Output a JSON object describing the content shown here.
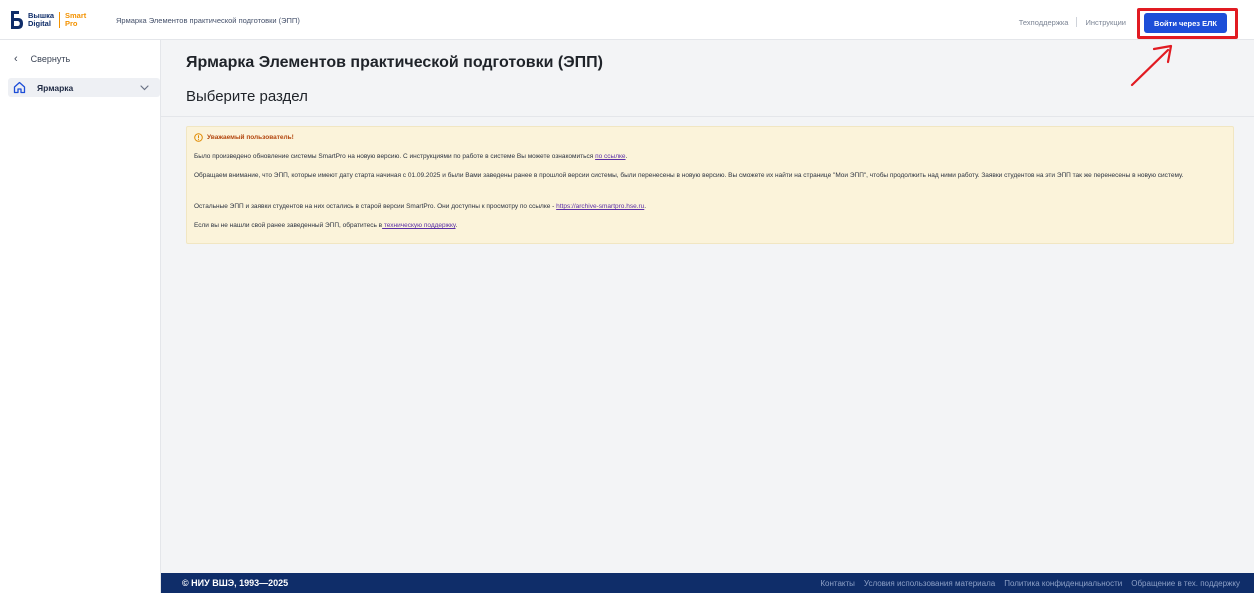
{
  "header": {
    "logo_line1": "Вышка",
    "logo_line2": "Digital",
    "logo_smart1": "Smart",
    "logo_smart2": "Pro",
    "title": "Ярмарка Элементов практической подготовки (ЭПП)",
    "support_link": "Техподдержка",
    "instructions_link": "Инструкции",
    "login_button": "Войти через ЕЛК"
  },
  "sidebar": {
    "collapse_label": "Свернуть",
    "items": [
      {
        "label": "Ярмарка",
        "icon": "home-icon"
      }
    ]
  },
  "main": {
    "page_title": "Ярмарка Элементов практической подготовки (ЭПП)",
    "section_title": "Выберите раздел"
  },
  "notice": {
    "heading": "Уважаемый пользователь!",
    "p1_text": "Было произведено обновление системы SmartPro на новую версию. С инструкциями по работе в системе Вы можете ознакомиться ",
    "p1_link": "по ссылке",
    "p1_end": ".",
    "p2_text": "Обращаем внимание, что ЭПП, которые имеют дату старта начиная с 01.09.2025 и были Вами заведены ранее в прошлой версии системы, были перенесены в новую версию. Вы сможете их найти на странице \"Мои ЭПП\", чтобы продолжить над ними работу. Заявки студентов на эти ЭПП так же перенесены в новую систему.",
    "p3_text": "Остальные ЭПП и заявки студентов на них остались в старой версии SmartPro. Они доступны к просмотру по ссылке - ",
    "p3_link": "https://archive-smartpro.hse.ru",
    "p3_end": ".",
    "p4_text": "Если вы не нашли свой ранее заведенный ЭПП, обратитесь в",
    "p4_link": " техническую поддержку",
    "p4_end": "."
  },
  "footer": {
    "copyright": "© НИУ ВШЭ, 1993—2025",
    "links": [
      "Контакты",
      "Условия использования материала",
      "Политика конфиденциальности",
      "Обращение в тех. поддержку"
    ]
  },
  "colors": {
    "primary_button": "#1d4ed8",
    "highlight": "#e11b22",
    "footer_bg": "#0f2d69",
    "notice_bg": "#fbf3da",
    "brand_orange": "#f39200"
  }
}
